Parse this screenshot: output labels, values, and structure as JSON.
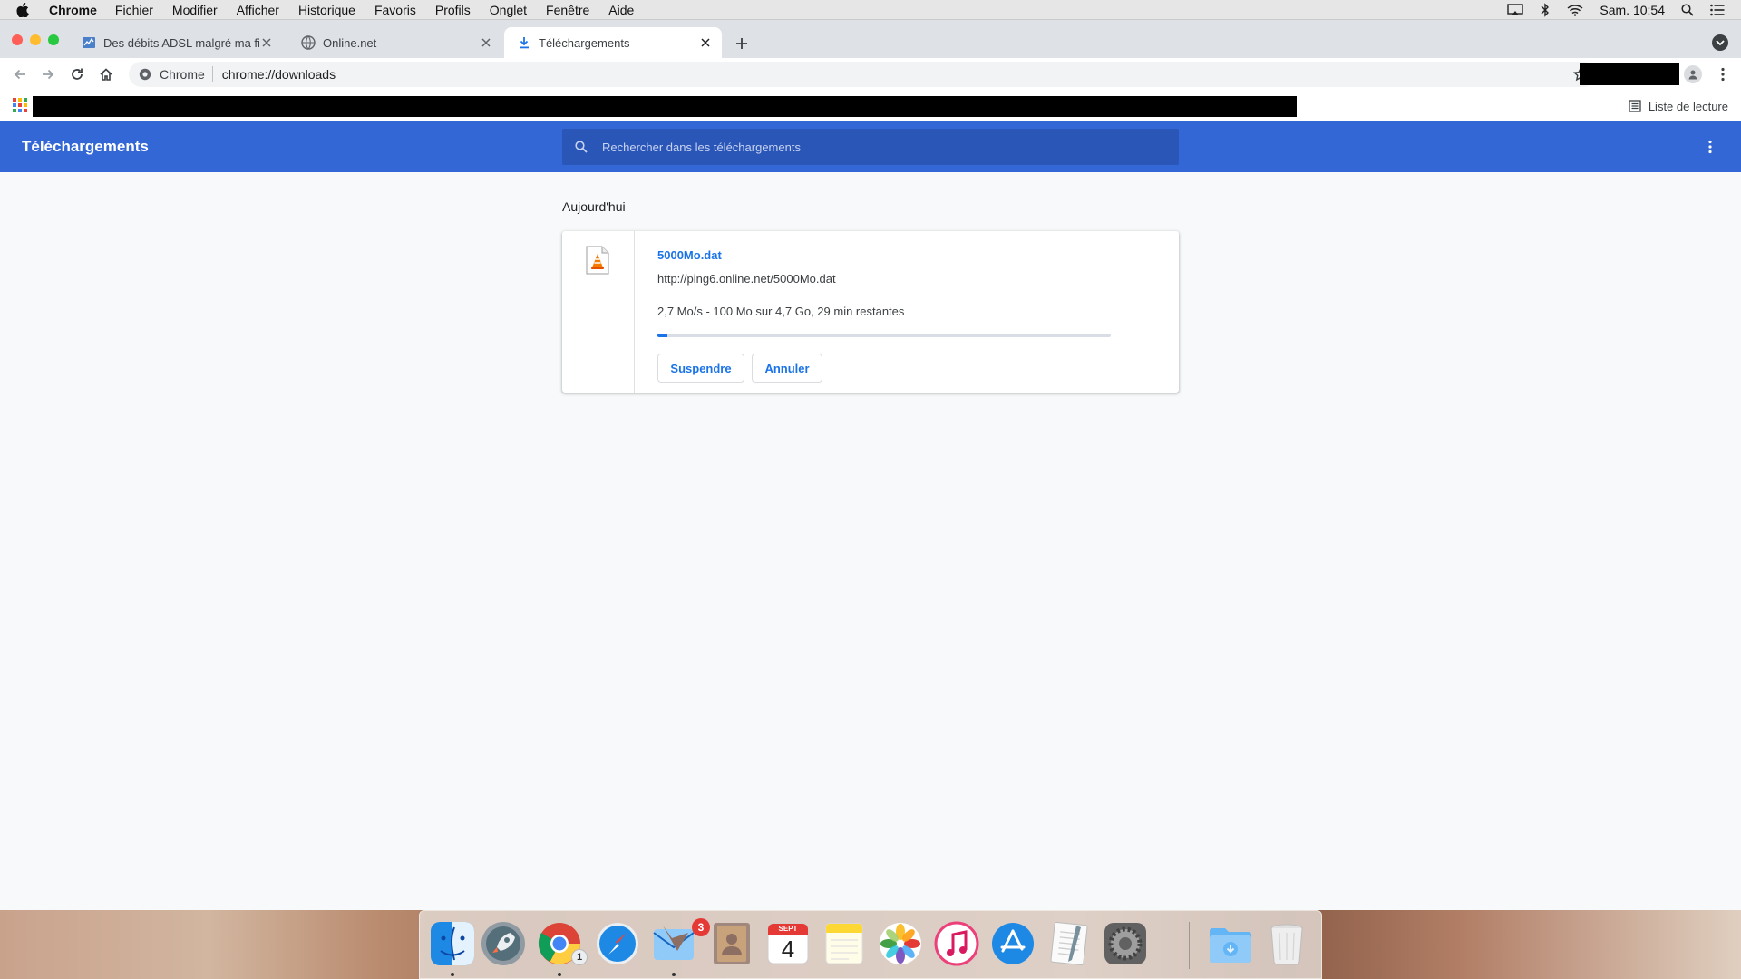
{
  "menubar": {
    "app": "Chrome",
    "items": [
      "Fichier",
      "Modifier",
      "Afficher",
      "Historique",
      "Favoris",
      "Profils",
      "Onglet",
      "Fenêtre",
      "Aide"
    ],
    "clock": "Sam. 10:54"
  },
  "tabs": [
    {
      "title": "Des débits ADSL malgré ma fib",
      "active": false
    },
    {
      "title": "Online.net",
      "active": false
    },
    {
      "title": "Téléchargements",
      "active": true
    }
  ],
  "omnibox": {
    "site": "Chrome",
    "url": "chrome://downloads"
  },
  "bookmarks": {
    "reading_list": "Liste de lecture"
  },
  "downloads": {
    "title": "Téléchargements",
    "search_placeholder": "Rechercher dans les téléchargements",
    "date_header": "Aujourd'hui",
    "item": {
      "file_name": "5000Mo.dat",
      "url": "http://ping6.online.net/5000Mo.dat",
      "status": "2,7 Mo/s - 100 Mo sur 4,7 Go, 29 min restantes",
      "progress": 0.021,
      "pause_label": "Suspendre",
      "cancel_label": "Annuler"
    }
  },
  "dock": {
    "icons": [
      "finder-icon",
      "launchpad-icon",
      "chrome-icon",
      "safari-icon",
      "mail-icon",
      "contacts-icon",
      "calendar-icon",
      "notes-icon",
      "photos-icon",
      "itunes-icon",
      "app-store-icon",
      "textedit-icon",
      "system-preferences-icon",
      "downloads-folder-icon",
      "trash-icon"
    ],
    "chrome_badge": "1",
    "mail_badge": "3",
    "calendar_month": "SEPT",
    "calendar_day": "4"
  },
  "colors": {
    "header_blue": "#3367d6",
    "link_blue": "#1a73e8",
    "page_bg": "#f8f9fa"
  }
}
